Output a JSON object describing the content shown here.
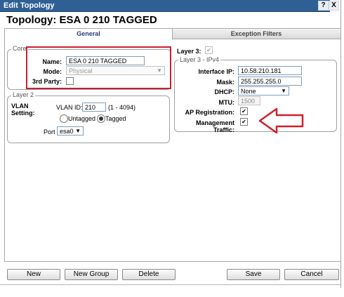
{
  "window": {
    "title": "Edit Topology",
    "help_label": "?",
    "close_label": "X"
  },
  "page_title": "Topology: ESA 0 210 TAGGED",
  "tabs": [
    {
      "label": "General",
      "active": true
    },
    {
      "label": "Exception Filters",
      "active": false
    }
  ],
  "core": {
    "legend": "Core",
    "name_label": "Name:",
    "name_value": "ESA 0 210 TAGGED",
    "mode_label": "Mode:",
    "mode_value": "Physical",
    "third_party_label": "3rd Party:",
    "third_party_checked": false
  },
  "layer2": {
    "legend": "Layer 2",
    "vlan_setting_label": "VLAN Setting:",
    "vlan_id_label": "VLAN ID:",
    "vlan_id_value": "210",
    "vlan_range": "(1 - 4094)",
    "untagged_label": "Untagged",
    "tagged_label": "Tagged",
    "selected": "Tagged",
    "port_label": "Port",
    "port_value": "esa0"
  },
  "layer3": {
    "label": "Layer 3:",
    "checked": true
  },
  "ipv4": {
    "legend": "Layer 3 - IPv4",
    "interface_ip_label": "Interface IP:",
    "interface_ip_value": "10.58.210.181",
    "mask_label": "Mask:",
    "mask_value": "255.255.255.0",
    "dhcp_label": "DHCP:",
    "dhcp_value": "None",
    "mtu_label": "MTU:",
    "mtu_value": "1500",
    "ap_registration_label": "AP Registration:",
    "ap_registration_checked": true,
    "management_traffic_label": "Management Traffic:",
    "management_traffic_checked": true
  },
  "buttons": {
    "new": "New",
    "new_group": "New Group",
    "delete": "Delete",
    "save": "Save",
    "cancel": "Cancel"
  },
  "colors": {
    "titlebar": "#2f6095",
    "highlight_box": "#c8202f",
    "arrow": "#d0202c"
  },
  "glyphs": {
    "check": "✔",
    "dropdown": "▼"
  }
}
